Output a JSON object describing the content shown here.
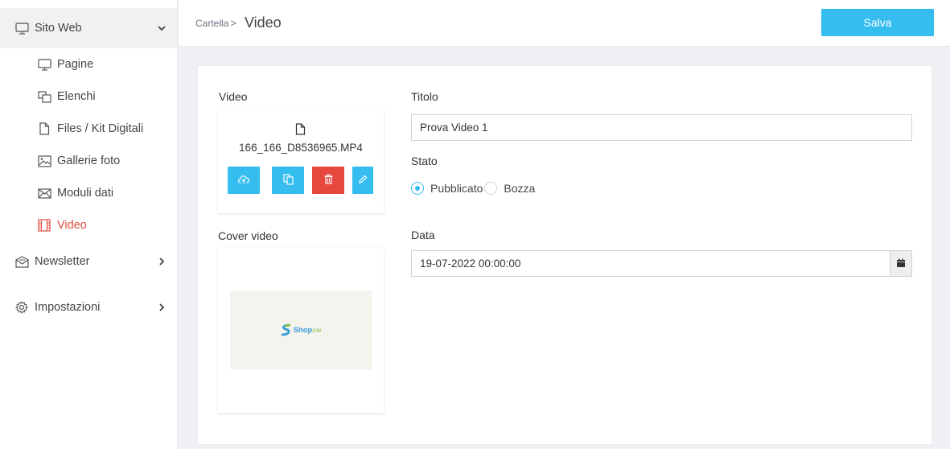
{
  "colors": {
    "accent": "#35bdf0",
    "danger": "#e6483d",
    "active_text": "#e24c3f"
  },
  "sidebar": {
    "group_sito": {
      "label": "Sito Web",
      "icon": "monitor-icon"
    },
    "items": [
      {
        "label": "Pagine",
        "icon": "monitor-icon"
      },
      {
        "label": "Elenchi",
        "icon": "list-stack-icon"
      },
      {
        "label": "Files / Kit Digitali",
        "icon": "file-icon"
      },
      {
        "label": "Gallerie foto",
        "icon": "gallery-icon"
      },
      {
        "label": "Moduli dati",
        "icon": "envelope-icon"
      },
      {
        "label": "Video",
        "icon": "film-icon"
      }
    ],
    "group_newsletter": {
      "label": "Newsletter",
      "icon": "newsletter-icon"
    },
    "group_impostazioni": {
      "label": "Impostazioni",
      "icon": "gear-icon"
    }
  },
  "header": {
    "breadcrumb": "Cartella",
    "breadcrumb_sep": ">",
    "title": "Video",
    "save_label": "Salva"
  },
  "form": {
    "video_label": "Video",
    "file_name": "166_166_D8536965.MP4",
    "cover_label": "Cover video",
    "cover_logo_text": "Shop",
    "cover_logo_suffix": "me",
    "title_label": "Titolo",
    "title_value": "Prova Video 1",
    "state_label": "Stato",
    "state_options": [
      "Pubblicato",
      "Bozza"
    ],
    "state_selected": "Pubblicato",
    "date_label": "Data",
    "date_value": "19-07-2022 00:00:00"
  }
}
